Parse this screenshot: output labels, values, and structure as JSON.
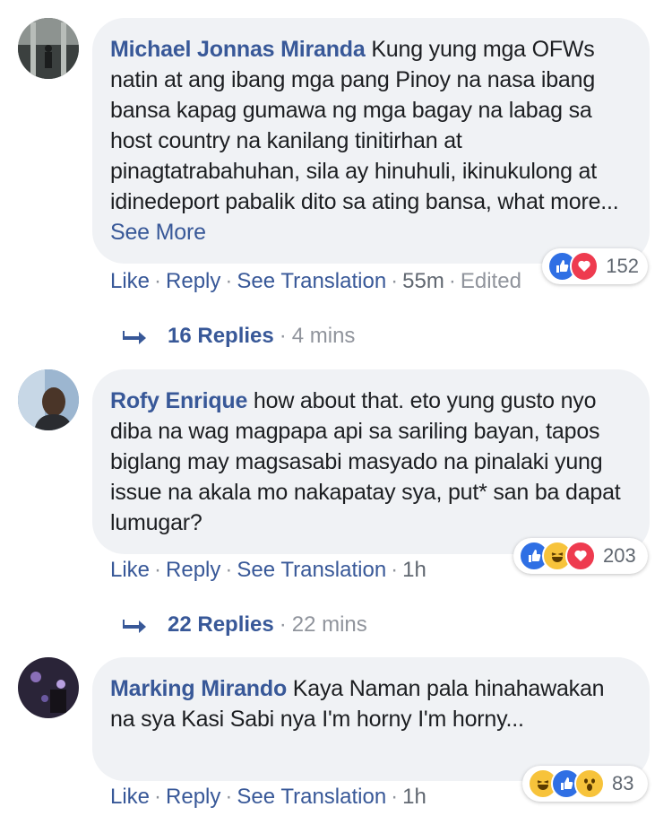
{
  "comments": [
    {
      "author": "Michael Jonnas Miranda",
      "text": "Kung yung mga OFWs natin at ang ibang mga pang Pinoy na nasa ibang bansa kapag gumawa ng mga bagay na labag sa host country na kanilang tinitirhan at pinagtatrabahuhan, sila ay hinuhuli, ikinukulong at idinedeport pabalik dito sa ating bansa, what more...",
      "see_more": "See More",
      "reactions": {
        "icons": [
          "like",
          "love"
        ],
        "count": "152"
      },
      "actions": {
        "like": "Like",
        "reply": "Reply",
        "translate": "See Translation",
        "time": "55m",
        "edited": "Edited"
      },
      "replies": {
        "count": "16 Replies",
        "ago": "4 mins"
      }
    },
    {
      "author": "Rofy Enrique",
      "text": "how about that. eto yung gusto nyo diba na wag magpapa api sa sariling bayan, tapos biglang may magsasabi masyado na pinalaki yung issue na akala mo nakapatay sya, put* san ba dapat lumugar?",
      "reactions": {
        "icons": [
          "like",
          "haha",
          "love"
        ],
        "count": "203"
      },
      "actions": {
        "like": "Like",
        "reply": "Reply",
        "translate": "See Translation",
        "time": "1h"
      },
      "replies": {
        "count": "22 Replies",
        "ago": "22 mins"
      }
    },
    {
      "author": "Marking Mirando",
      "text": "Kaya Naman pala hinahawakan na sya Kasi Sabi nya I'm horny I'm horny...",
      "reactions": {
        "icons": [
          "haha",
          "like",
          "wow"
        ],
        "count": "83"
      },
      "actions": {
        "like": "Like",
        "reply": "Reply",
        "translate": "See Translation",
        "time": "1h"
      }
    }
  ],
  "separator": "·",
  "colors": {
    "link": "#385898",
    "bubble": "#f0f2f5",
    "meta": "#90949c",
    "like": "#2f6fe4",
    "love": "#ee3b4f",
    "haha": "#f7c33b"
  }
}
